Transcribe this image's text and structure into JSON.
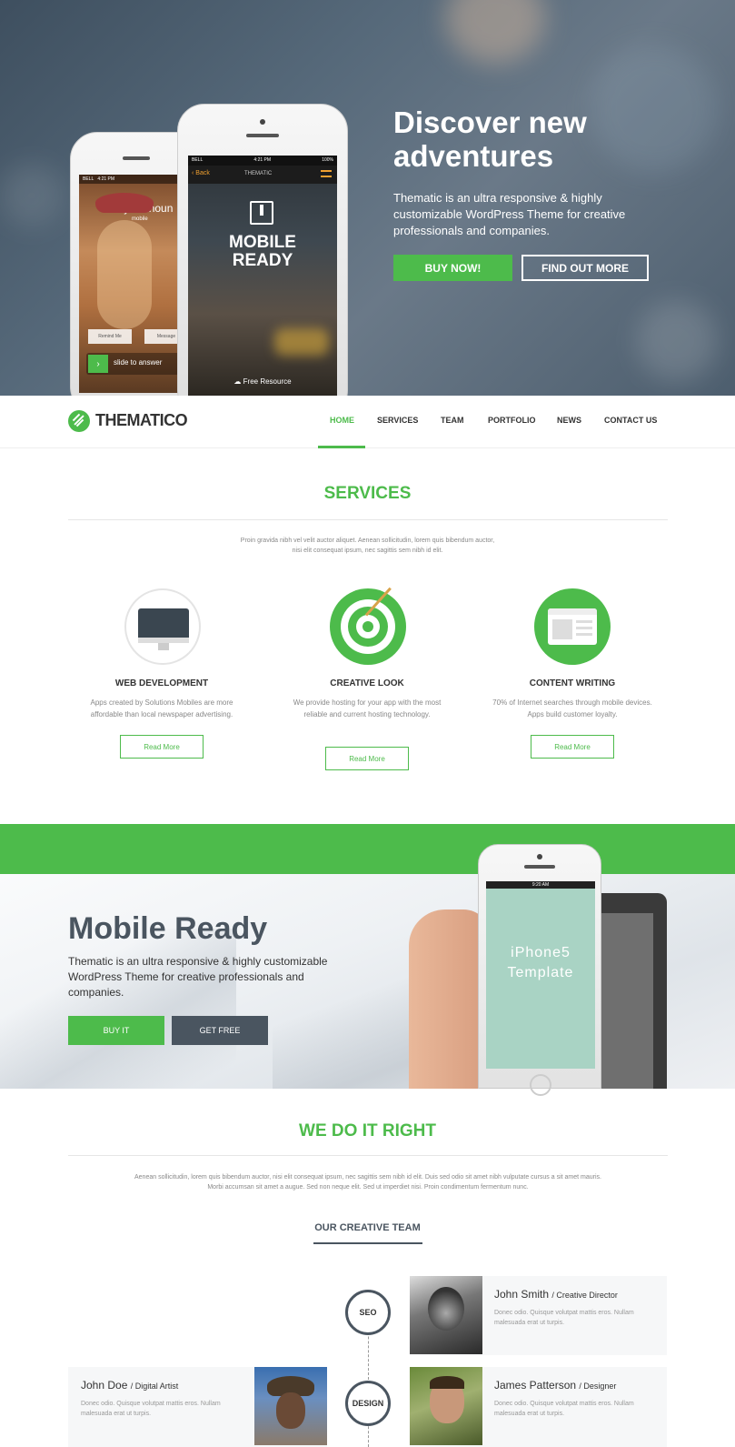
{
  "hero": {
    "title_line1": "Discover new",
    "title_line2": "adventures",
    "description": "Thematic is an ultra responsive & highly customizable WordPress Theme for creative professionals and companies.",
    "buy_label": "BUY NOW!",
    "find_label": "FIND OUT MORE",
    "phone_left": {
      "status_carrier": "BELL",
      "time": "4:21 PM",
      "caller": "Lucy Calhoun",
      "caller_sub": "mobile",
      "remind": "Remind Me",
      "message": "Message",
      "slide": "slide to answer"
    },
    "phone_right": {
      "status_carrier": "BELL",
      "time": "4:21 PM",
      "battery": "100%",
      "back": "Back",
      "app_title": "THEMATIC",
      "headline_line1": "MOBILE",
      "headline_line2": "READY",
      "footer": "Free Resource"
    }
  },
  "nav": {
    "logo": "THEMATICO",
    "items": [
      "HOME",
      "SERVICES",
      "TEAM",
      "PORTFOLIO",
      "NEWS",
      "CONTACT US"
    ]
  },
  "services": {
    "title": "SERVICES",
    "lead_line1": "Proin gravida nibh vel velit auctor aliquet. Aenean sollicitudin, lorem quis bibendum auctor,",
    "lead_line2": "nisi elit consequat ipsum, nec sagittis sem nibh id elit.",
    "items": [
      {
        "title": "WEB DEVELOPMENT",
        "text": "Apps created by Solutions Mobiles are more affordable than local newspaper advertising.",
        "button": "Read More"
      },
      {
        "title": "CREATIVE LOOK",
        "text": "We provide hosting for your app with the most reliable and current hosting technology.",
        "button": "Read More"
      },
      {
        "title": "CONTENT WRITING",
        "text": "70% of Internet searches through mobile devices. Apps build customer loyalty.",
        "button": "Read More"
      }
    ]
  },
  "mobile_ready": {
    "title": "Mobile Ready",
    "text": "Thematic is an ultra responsive & highly customizable WordPress Theme for creative professionals and companies.",
    "buy_label": "BUY IT",
    "free_label": "GET FREE",
    "phone_time": "9:20 AM",
    "phone_screen_line1": "iPhone5",
    "phone_screen_line2": "Template"
  },
  "right": {
    "title": "WE DO IT RIGHT",
    "lead_line1": "Aenean sollicitudin, lorem quis bibendum auctor, nisi elit consequat ipsum, nec sagittis sem nibh id elit. Duis sed odio sit amet nibh vulputate cursus a sit amet mauris.",
    "lead_line2": "Morbi accumsan sit amet a augue. Sed non neque elit. Sed ut imperdiet nisi. Proin condimentum fermentum nunc.",
    "team_heading": "OUR CREATIVE TEAM"
  },
  "team": {
    "timeline": [
      "SEO",
      "DESIGN"
    ],
    "members": [
      {
        "name": "John Smith",
        "role": "/ Creative Director",
        "text_line1": "Donec odio. Quisque volutpat mattis eros. Nullam",
        "text_line2": "malesuada erat ut turpis."
      },
      {
        "name": "John Doe",
        "role": "/ Digital Artist",
        "text_line1": "Donec odio. Quisque volutpat mattis eros. Nullam",
        "text_line2": "malesuada erat ut turpis."
      },
      {
        "name": "James Patterson",
        "role": "/ Designer",
        "text_line1": "Donec odio. Quisque volutpat mattis eros. Nullam",
        "text_line2": "malesuada erat ut turpis."
      }
    ]
  },
  "colors": {
    "accent": "#4dbb4b",
    "dark": "#4a5560"
  }
}
